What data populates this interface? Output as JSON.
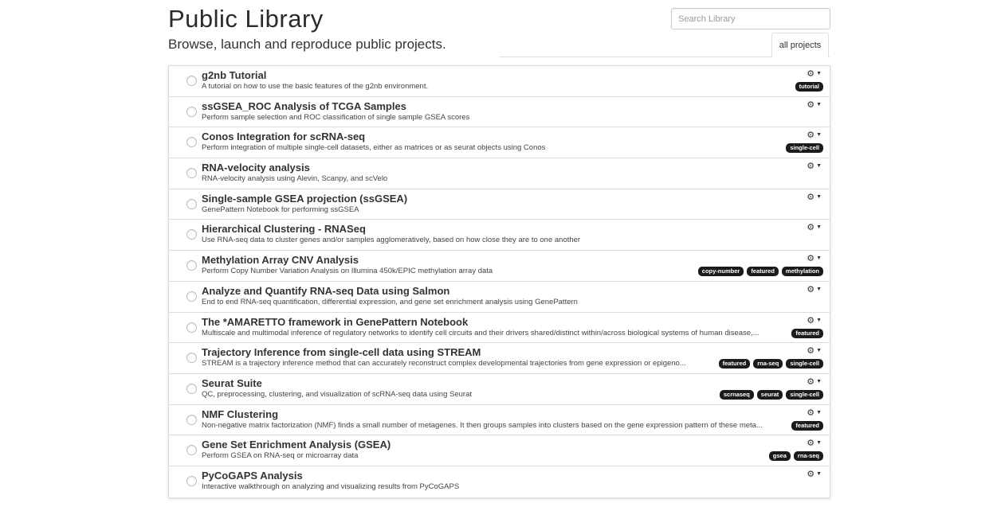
{
  "header": {
    "title": "Public Library",
    "subtitle": "Browse, launch and reproduce public projects.",
    "search_placeholder": "Search Library",
    "tab_all": "all projects"
  },
  "projects": [
    {
      "title": "g2nb Tutorial",
      "desc": "A tutorial on how to use the basic features of the g2nb environment.",
      "tags": [
        "tutorial"
      ]
    },
    {
      "title": "ssGSEA_ROC Analysis of TCGA Samples",
      "desc": "Perform sample selection and ROC classification of single sample GSEA scores",
      "tags": []
    },
    {
      "title": "Conos Integration for scRNA-seq",
      "desc": "Perform integration of multiple single-cell datasets, either as matrices or as seurat objects using Conos",
      "tags": [
        "single-cell"
      ]
    },
    {
      "title": "RNA-velocity analysis",
      "desc": "RNA-velocity analysis using Alevin, Scanpy, and scVelo",
      "tags": []
    },
    {
      "title": "Single-sample GSEA projection (ssGSEA)",
      "desc": "GenePattern Notebook for performing ssGSEA",
      "tags": []
    },
    {
      "title": "Hierarchical Clustering - RNASeq",
      "desc": "Use RNA-seq data to cluster genes and/or samples agglomeratively, based on how close they are to one another",
      "tags": []
    },
    {
      "title": "Methylation Array CNV Analysis",
      "desc": "Perform Copy Number Variation Analysis on Illumina 450k/EPIC methylation array data",
      "tags": [
        "copy-number",
        "featured",
        "methylation"
      ]
    },
    {
      "title": "Analyze and Quantify RNA-seq Data using Salmon",
      "desc": "End to end RNA-seq quantification, differential expression, and gene set enrichment analysis using GenePattern",
      "tags": []
    },
    {
      "title": "The *AMARETTO framework in GenePattern Notebook",
      "desc": "Multiscale and multimodal inference of regulatory networks to identify cell circuits and their drivers shared/distinct within/across biological systems of human disease,...",
      "tags": [
        "featured"
      ]
    },
    {
      "title": "Trajectory Inference from single-cell data using STREAM",
      "desc": "STREAM is a trajectory inference method that can accurately reconstruct complex developmental trajectories from gene expression or epigeno...",
      "tags": [
        "featured",
        "rna-seq",
        "single-cell"
      ]
    },
    {
      "title": "Seurat Suite",
      "desc": "QC, preprocessing, clustering, and visualization of scRNA-seq data using Seurat",
      "tags": [
        "scrnaseq",
        "seurat",
        "single-cell"
      ]
    },
    {
      "title": "NMF Clustering",
      "desc": "Non-negative matrix factorization (NMF) finds a small number of metagenes. It then groups samples into clusters based on the gene expression pattern of these meta...",
      "tags": [
        "featured"
      ]
    },
    {
      "title": "Gene Set Enrichment Analysis (GSEA)",
      "desc": "Perform GSEA on RNA-seq or microarray data",
      "tags": [
        "gsea",
        "rna-seq"
      ]
    },
    {
      "title": "PyCoGAPS Analysis",
      "desc": "Interactive walkthrough on analyzing and visualizing results from PyCoGAPS",
      "tags": []
    }
  ]
}
